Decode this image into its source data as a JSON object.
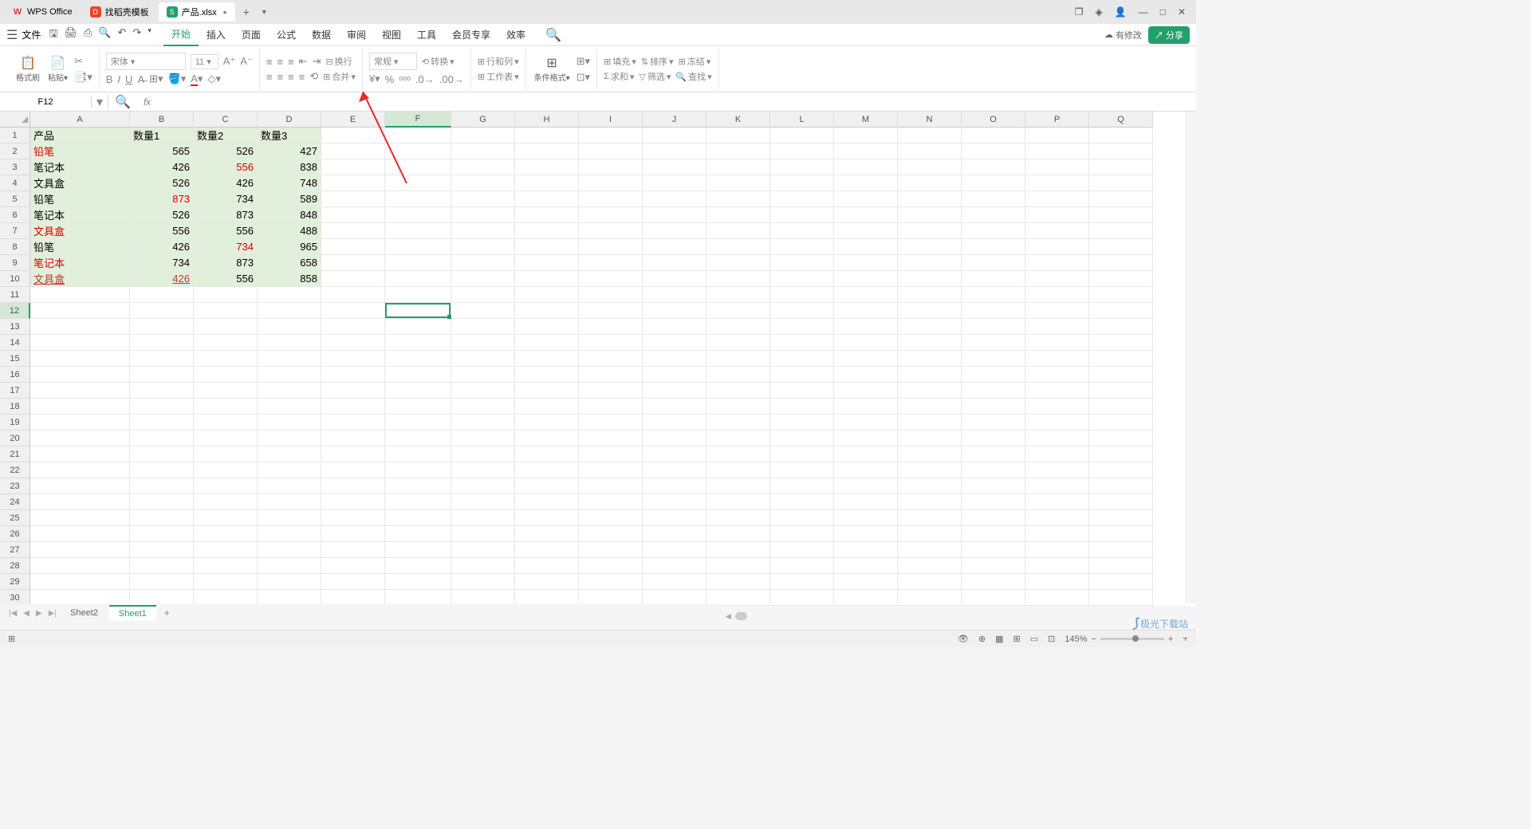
{
  "titlebar": {
    "app": "WPS Office",
    "tab2": "找稻壳模板",
    "tab3": "产品.xlsx"
  },
  "menu": {
    "file": "文件",
    "items": [
      "开始",
      "插入",
      "页面",
      "公式",
      "数据",
      "审阅",
      "视图",
      "工具",
      "会员专享",
      "效率"
    ],
    "cloud": "有修改",
    "share": "分享"
  },
  "ribbon": {
    "fmtbrush": "格式刷",
    "paste": "粘贴",
    "font": "宋体",
    "size": "11",
    "wrap": "换行",
    "merge": "合并",
    "numfmt": "常规",
    "convert": "转换",
    "rowcol": "行和列",
    "worksheet": "工作表",
    "condfmt": "条件格式",
    "fill": "填充",
    "sort": "排序",
    "freeze": "冻结",
    "sum": "求和",
    "filter": "筛选",
    "find": "查找"
  },
  "namebox": "F12",
  "cols": [
    "A",
    "B",
    "C",
    "D",
    "E",
    "F",
    "G",
    "H",
    "I",
    "J",
    "K",
    "L",
    "M",
    "N",
    "O",
    "P",
    "Q"
  ],
  "headers": [
    "产品",
    "数量1",
    "数量2",
    "数量3"
  ],
  "rows": [
    {
      "p": "铅笔",
      "pstyle": "red",
      "v": [
        565,
        526,
        427
      ],
      "s": [
        "",
        "",
        ""
      ]
    },
    {
      "p": "笔记本",
      "pstyle": "",
      "v": [
        426,
        556,
        838
      ],
      "s": [
        "",
        "red",
        ""
      ]
    },
    {
      "p": "文具盒",
      "pstyle": "",
      "v": [
        526,
        426,
        748
      ],
      "s": [
        "",
        "",
        ""
      ]
    },
    {
      "p": "铅笔",
      "pstyle": "",
      "v": [
        873,
        734,
        589
      ],
      "s": [
        "red",
        "",
        ""
      ]
    },
    {
      "p": "笔记本",
      "pstyle": "",
      "v": [
        526,
        873,
        848
      ],
      "s": [
        "",
        "",
        ""
      ]
    },
    {
      "p": "文具盒",
      "pstyle": "red",
      "v": [
        556,
        556,
        488
      ],
      "s": [
        "",
        "",
        ""
      ]
    },
    {
      "p": "铅笔",
      "pstyle": "",
      "v": [
        426,
        734,
        965
      ],
      "s": [
        "",
        "red",
        ""
      ]
    },
    {
      "p": "笔记本",
      "pstyle": "red",
      "v": [
        734,
        873,
        658
      ],
      "s": [
        "",
        "",
        ""
      ]
    },
    {
      "p": "文具盒",
      "pstyle": "redlink",
      "v": [
        426,
        556,
        858
      ],
      "s": [
        "redlink",
        "",
        ""
      ]
    }
  ],
  "sheets": {
    "s1": "Sheet2",
    "s2": "Sheet1"
  },
  "status": {
    "zoom": "145%"
  },
  "watermark": "极光下载站"
}
